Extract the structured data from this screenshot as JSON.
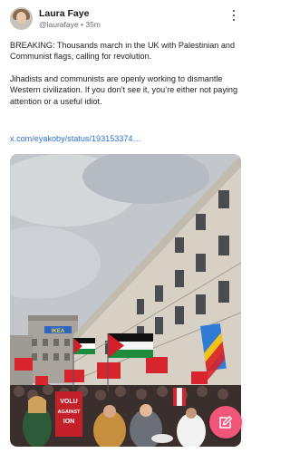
{
  "post": {
    "author_name": "Laura Faye",
    "author_handle": "@laurafaye",
    "separator": "•",
    "time_ago": "35m",
    "paragraph1": "BREAKING: Thousands march in the UK with Palestinian and Communist flags, calling for revolution.",
    "paragraph2": "Jihadists and communists are openly working to dismantle Western civilization. If you don’t see it, you’re either not paying attention or a useful idiot.",
    "link": "x.com/eyakoby/status/193153374…"
  },
  "media": {
    "shop_sign": "IKEA",
    "placard_lines": [
      "VOLU",
      "AGAINST",
      "ION"
    ]
  },
  "icons": {
    "more": "more-vertical-icon",
    "compose": "compose-icon"
  },
  "colors": {
    "link": "#2f6fd6",
    "fab": "#f2557a"
  }
}
